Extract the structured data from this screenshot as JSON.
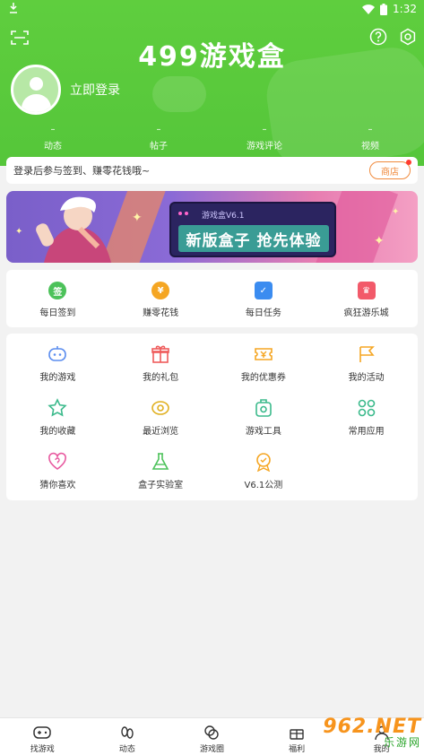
{
  "status_bar": {
    "time": "1:32"
  },
  "header": {
    "title": "499游戏盒",
    "login_label": "立即登录",
    "stats": [
      {
        "value": "–",
        "label": "动态"
      },
      {
        "value": "–",
        "label": "帖子"
      },
      {
        "value": "–",
        "label": "游戏评论"
      },
      {
        "value": "–",
        "label": "视频"
      }
    ],
    "icons": [
      "scan-icon",
      "help-icon",
      "settings-icon"
    ]
  },
  "notice": {
    "text": "登录后参与签到、赚零花钱哦~",
    "shop_label": "商店"
  },
  "banner": {
    "version_text": "游戏盒V6.1",
    "headline": "新版盒子 抢先体验"
  },
  "quick_actions": [
    {
      "label": "每日签到",
      "icon": "checkin-icon",
      "color": "#4cc25a",
      "glyph": "签"
    },
    {
      "label": "赚零花钱",
      "icon": "coin-icon",
      "color": "#f5a623",
      "glyph": "¥"
    },
    {
      "label": "每日任务",
      "icon": "task-icon",
      "color": "#3b8cf0",
      "glyph": "✓"
    },
    {
      "label": "疯狂游乐城",
      "icon": "crown-icon",
      "color": "#f25a6a",
      "glyph": "♛"
    }
  ],
  "grid": [
    {
      "label": "我的游戏",
      "icon": "gamepad-icon",
      "color": "#5b8def"
    },
    {
      "label": "我的礼包",
      "icon": "gift-icon",
      "color": "#ef5b5b"
    },
    {
      "label": "我的优惠券",
      "icon": "coupon-icon",
      "color": "#f5a623"
    },
    {
      "label": "我的活动",
      "icon": "flag-icon",
      "color": "#f5a623"
    },
    {
      "label": "我的收藏",
      "icon": "star-icon",
      "color": "#3cba8c"
    },
    {
      "label": "最近浏览",
      "icon": "eye-icon",
      "color": "#e0b020"
    },
    {
      "label": "游戏工具",
      "icon": "tool-icon",
      "color": "#3cba8c"
    },
    {
      "label": "常用应用",
      "icon": "apps-icon",
      "color": "#3cba8c"
    },
    {
      "label": "猜你喜欢",
      "icon": "heart-icon",
      "color": "#e85aa0"
    },
    {
      "label": "盒子实验室",
      "icon": "lab-icon",
      "color": "#4cc25a"
    },
    {
      "label": "V6.1公测",
      "icon": "badge-icon",
      "color": "#f5a623"
    }
  ],
  "tabs": [
    {
      "label": "找游戏",
      "icon": "controller-tab-icon"
    },
    {
      "label": "动态",
      "icon": "footprint-tab-icon"
    },
    {
      "label": "游戏圈",
      "icon": "circle-tab-icon"
    },
    {
      "label": "福利",
      "icon": "gift-tab-icon"
    },
    {
      "label": "我的",
      "icon": "profile-tab-icon"
    }
  ],
  "watermark": {
    "big": "962.NET",
    "small": "乐游网"
  }
}
